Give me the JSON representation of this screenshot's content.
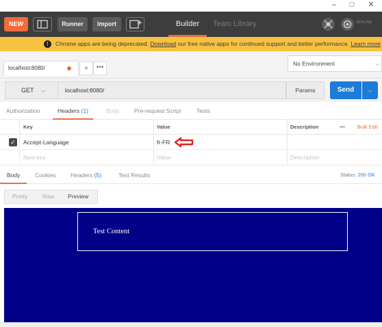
{
  "window_controls": {
    "minimize": "–",
    "maximize": "□",
    "close": "✕"
  },
  "toolbar": {
    "new_label": "NEW",
    "runner_label": "Runner",
    "import_label": "Import",
    "nav_builder": "Builder",
    "nav_team_library": "Team Library",
    "offline_label": "OFFLINE",
    "accent_color": "#f26b3a"
  },
  "banner": {
    "text_before": "Chrome apps are being deprecated. ",
    "download_link": "Download",
    "text_after": " our free native apps for continued support and better performance. ",
    "learn_more_link": "Learn more",
    "color": "#f8c241"
  },
  "request_tab": {
    "label": "localhost:8080/",
    "plus": "+",
    "more": "•••"
  },
  "environment": {
    "selected": "No Environment"
  },
  "request": {
    "method": "GET",
    "url": "localhost:8080/",
    "params_label": "Params",
    "send_label": "Send",
    "send_color": "#1d7bd9"
  },
  "request_tabs": {
    "authorization": "Authorization",
    "headers": "Headers",
    "headers_count": "(1)",
    "body": "Body",
    "prerequest": "Pre-request Script",
    "tests": "Tests"
  },
  "headers_table": {
    "col_key": "Key",
    "col_value": "Value",
    "col_description": "Description",
    "more": "•••",
    "bulk_edit": "Bulk Edit",
    "rows": [
      {
        "checked": true,
        "key": "Accept-Language",
        "value": "fr-FR",
        "description": ""
      }
    ],
    "new_row": {
      "key_placeholder": "New key",
      "value_placeholder": "Value",
      "description_placeholder": "Description"
    }
  },
  "response_tabs": {
    "body": "Body",
    "cookies": "Cookies",
    "headers": "Headers",
    "headers_count": "(5)",
    "test_results": "Test Results",
    "status_label": "Status:",
    "status_code": "200 OK"
  },
  "view_modes": {
    "pretty": "Pretty",
    "raw": "Raw",
    "preview": "Preview",
    "selected": "Preview"
  },
  "preview_content": {
    "text": "Test Content",
    "background_color": "#000088"
  }
}
